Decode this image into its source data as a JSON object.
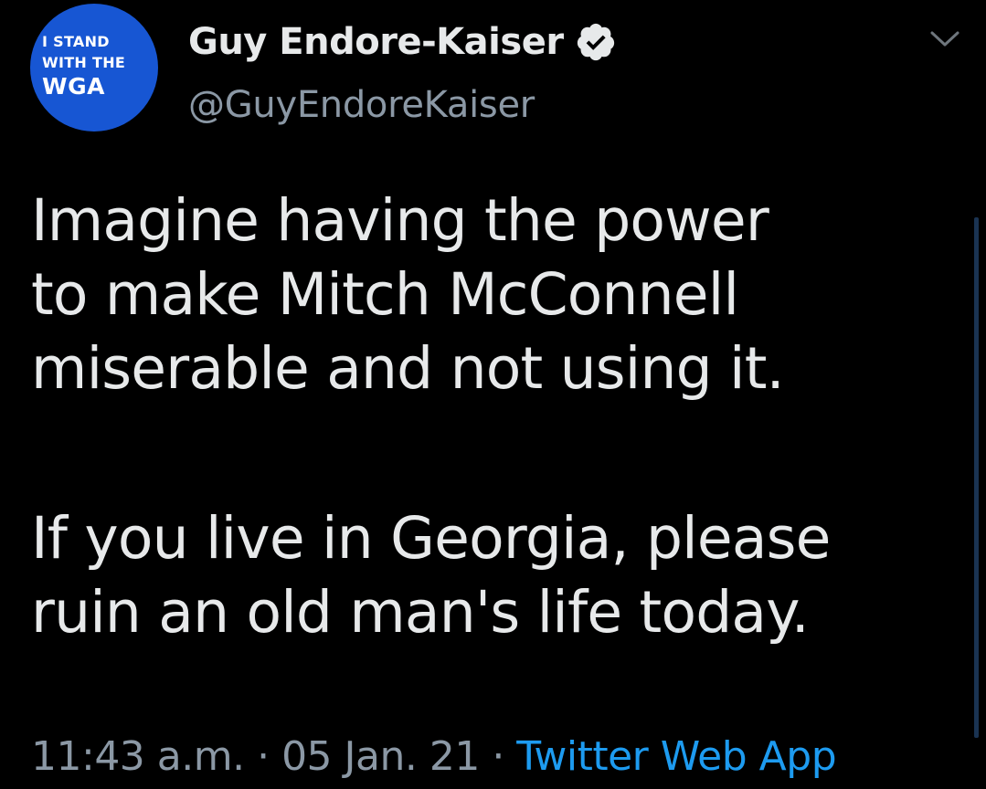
{
  "author": {
    "avatar_lines": [
      "I STAND",
      "WITH THE",
      "WGA"
    ],
    "display_name": "Guy Endore-Kaiser",
    "handle": "@GuyEndoreKaiser",
    "verified_icon": "verified-badge-icon"
  },
  "tweet": {
    "paragraph_1": [
      "Imagine having the power",
      "to make Mitch McConnell",
      "miserable and not using it."
    ],
    "paragraph_2": [
      "If you live in Georgia, please",
      "ruin an old man's life today."
    ]
  },
  "meta": {
    "time": "11:43 a.m.",
    "separator": " · ",
    "date": "05 Jan. 21",
    "source": "Twitter Web App"
  },
  "colors": {
    "background": "#000000",
    "text": "#e7e9ea",
    "secondary": "#8b98a5",
    "link": "#1d9bf0",
    "avatar": "#1756d3"
  },
  "icons": {
    "menu": "chevron-down-icon"
  }
}
